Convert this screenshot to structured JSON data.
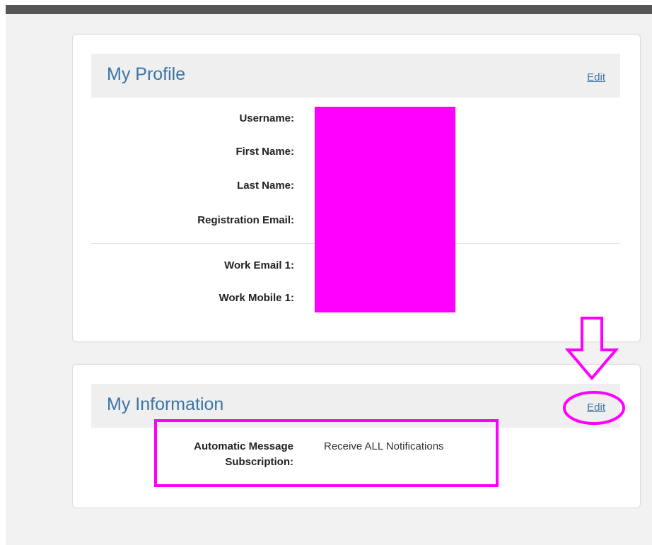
{
  "profile": {
    "title": "My Profile",
    "edit_label": "Edit",
    "fields": [
      {
        "label": "Username:"
      },
      {
        "label": "First Name:"
      },
      {
        "label": "Last Name:"
      },
      {
        "label": "Registration Email:"
      },
      {
        "label": "Work Email 1:"
      },
      {
        "label": "Work Mobile 1:"
      }
    ]
  },
  "information": {
    "title": "My Information",
    "edit_label": "Edit",
    "subscription_label_line1": "Automatic Message",
    "subscription_label_line2": "Subscription:",
    "subscription_value": "Receive ALL Notifications"
  },
  "annotations": {
    "color": "#ff00ff",
    "redaction_color": "#ff00ff"
  },
  "colors": {
    "link": "#3b74a6",
    "header_bg": "#efefef",
    "page_bg": "#f2f2f2"
  }
}
